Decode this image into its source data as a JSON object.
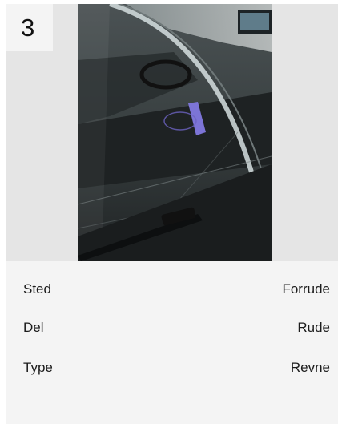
{
  "card": {
    "index": "3",
    "photo_alt": "Forrude med revne",
    "details": [
      {
        "label": "Sted",
        "value": "Forrude"
      },
      {
        "label": "Del",
        "value": "Rude"
      },
      {
        "label": "Type",
        "value": "Revne"
      }
    ]
  },
  "colors": {
    "card_bg": "#f4f4f4",
    "image_area_bg": "#e5e5e5",
    "text": "#1c1c1c"
  }
}
